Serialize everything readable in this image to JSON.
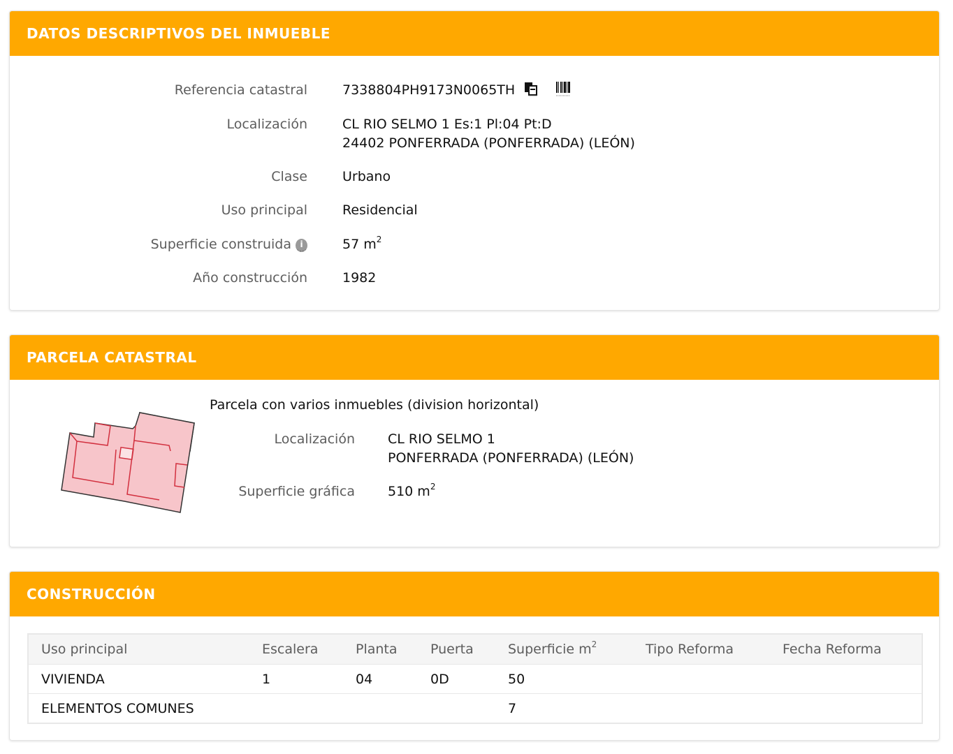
{
  "inmueble": {
    "title": "DATOS DESCRIPTIVOS DEL INMUEBLE",
    "rows": {
      "referencia": {
        "label": "Referencia catastral",
        "value": "7338804PH9173N0065TH"
      },
      "localizacion": {
        "label": "Localización",
        "line1": "CL RIO SELMO 1 Es:1 Pl:04 Pt:D",
        "line2": "24402 PONFERRADA (PONFERRADA) (LEÓN)"
      },
      "clase": {
        "label": "Clase",
        "value": "Urbano"
      },
      "uso": {
        "label": "Uso principal",
        "value": "Residencial"
      },
      "superficie": {
        "label": "Superficie construida",
        "value": "57 m",
        "sup": "2",
        "info_icon": "i"
      },
      "anio": {
        "label": "Año construcción",
        "value": "1982"
      }
    },
    "icons": [
      "copy-icon",
      "barcode-icon",
      "info-icon"
    ]
  },
  "parcela": {
    "title": "PARCELA CATASTRAL",
    "description": "Parcela con varios inmuebles (division horizontal)",
    "localizacion": {
      "label": "Localización",
      "line1": "CL RIO SELMO 1",
      "line2": "PONFERRADA (PONFERRADA) (LEÓN)"
    },
    "superficie": {
      "label": "Superficie gráfica",
      "value": "510 m",
      "sup": "2"
    }
  },
  "construccion": {
    "title": "CONSTRUCCIÓN",
    "headers": {
      "uso": "Uso principal",
      "escalera": "Escalera",
      "planta": "Planta",
      "puerta": "Puerta",
      "superficie": "Superficie m",
      "superficie_sup": "2",
      "tipo": "Tipo Reforma",
      "fecha": "Fecha Reforma"
    },
    "rows": [
      {
        "uso": "VIVIENDA",
        "escalera": "1",
        "planta": "04",
        "puerta": "0D",
        "superficie": "50",
        "tipo": "",
        "fecha": ""
      },
      {
        "uso": "ELEMENTOS COMUNES",
        "escalera": "",
        "planta": "",
        "puerta": "",
        "superficie": "7",
        "tipo": "",
        "fecha": ""
      }
    ]
  },
  "colors": {
    "header": "#ffa800",
    "parcel_fill": "#f7c5ca",
    "parcel_stroke": "#333333",
    "parcel_inner": "#d2303f"
  }
}
